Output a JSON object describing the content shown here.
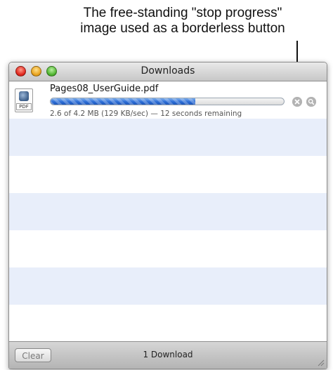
{
  "annotation": {
    "line1": "The free-standing \"stop progress\"",
    "line2": "image used as a borderless button"
  },
  "window": {
    "title": "Downloads"
  },
  "download": {
    "file_name": "Pages08_UserGuide.pdf",
    "file_type_label": "PDF",
    "progress_fraction": 0.62,
    "status": "2.6 of 4.2 MB (129 KB/sec) — 12 seconds remaining",
    "stop_icon": "stop-progress-icon",
    "reveal_icon": "magnifier-icon"
  },
  "footer": {
    "clear_label": "Clear",
    "count_label": "1 Download"
  },
  "colors": {
    "progress_fill": "#2c6dd6",
    "alternate_row": "#e8eefa",
    "close_button": "#e0261c",
    "minimize_button": "#e8a21d",
    "zoom_button": "#4fb42f"
  }
}
